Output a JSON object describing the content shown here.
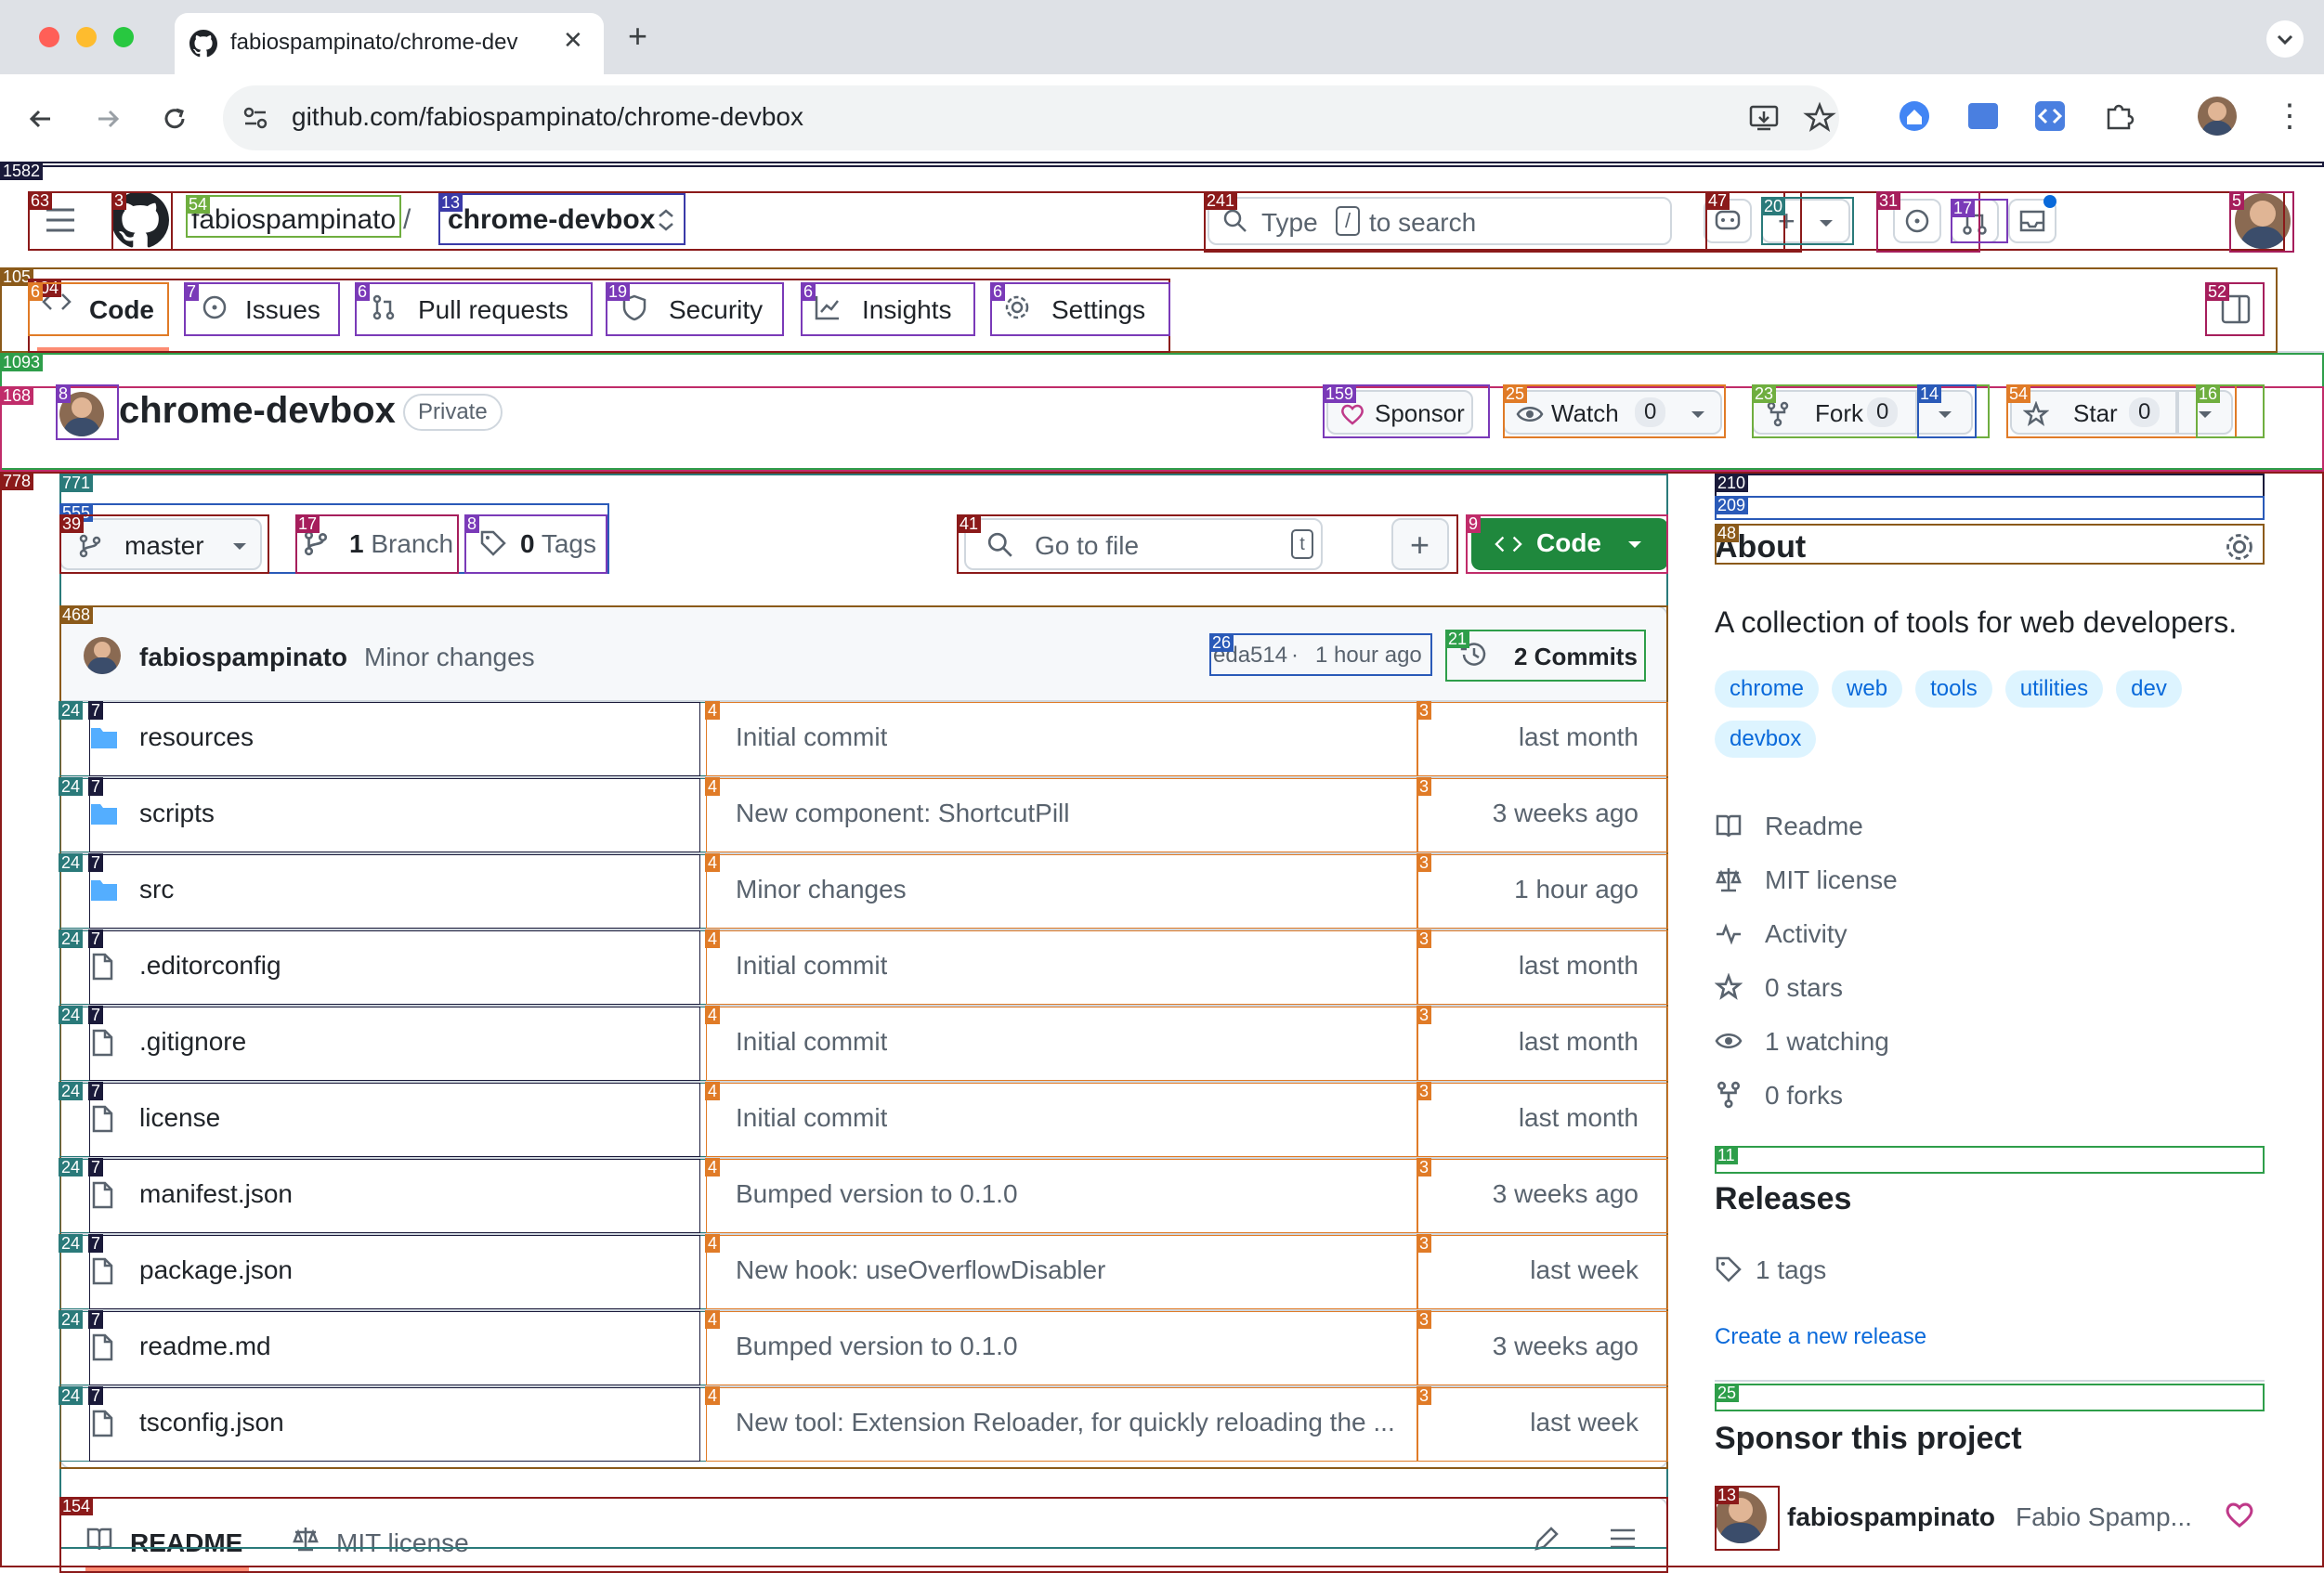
{
  "browser": {
    "tab_title": "fabiospampinato/chrome-dev",
    "new_tab": "+",
    "url": "github.com/fabiospampinato/chrome-devbox"
  },
  "header": {
    "owner": "fabiospampinato",
    "repo": "chrome-devbox",
    "search_placeholder_pre": "Type",
    "search_placeholder_post": "to search",
    "search_key": "/"
  },
  "nav": {
    "tabs": [
      {
        "label": "Code"
      },
      {
        "label": "Issues"
      },
      {
        "label": "Pull requests"
      },
      {
        "label": "Security"
      },
      {
        "label": "Insights"
      },
      {
        "label": "Settings"
      }
    ]
  },
  "repo_header": {
    "name": "chrome-devbox",
    "visibility": "Private",
    "sponsor": "Sponsor",
    "watch": "Watch",
    "watch_count": "0",
    "fork": "Fork",
    "fork_count": "0",
    "star": "Star",
    "star_count": "0"
  },
  "files_toolbar": {
    "branch": "master",
    "branches": "Branch",
    "tags": "Tags",
    "go_to_file": "Go to file",
    "code_button": "Code"
  },
  "latest_commit": {
    "author": "fabiospampinato",
    "message": "Minor changes",
    "hash": "eda514",
    "sep": "·",
    "time": "1 hour ago",
    "commits": "2 Commits"
  },
  "files": [
    {
      "name": "resources",
      "type": "folder",
      "message": "Initial commit",
      "date": "last month"
    },
    {
      "name": "scripts",
      "type": "folder",
      "message": "New component: ShortcutPill",
      "date": "3 weeks ago"
    },
    {
      "name": "src",
      "type": "folder",
      "message": "Minor changes",
      "date": "1 hour ago"
    },
    {
      "name": ".editorconfig",
      "type": "file",
      "message": "Initial commit",
      "date": "last month"
    },
    {
      "name": ".gitignore",
      "type": "file",
      "message": "Initial commit",
      "date": "last month"
    },
    {
      "name": "license",
      "type": "file",
      "message": "Initial commit",
      "date": "last month"
    },
    {
      "name": "manifest.json",
      "type": "file",
      "message": "Bumped version to 0.1.0",
      "date": "3 weeks ago"
    },
    {
      "name": "package.json",
      "type": "file",
      "message": "New hook: useOverflowDisabler",
      "date": "last week"
    },
    {
      "name": "readme.md",
      "type": "file",
      "message": "Bumped version to 0.1.0",
      "date": "3 weeks ago"
    },
    {
      "name": "tsconfig.json",
      "type": "file",
      "message": "New tool: Extension Reloader, for quickly reloading the ...",
      "date": "last week"
    }
  ],
  "readme_tabs": {
    "readme": "README",
    "license": "MIT license"
  },
  "about": {
    "title": "About",
    "description": "A collection of tools for web developers.",
    "topics": [
      "chrome",
      "web",
      "tools",
      "utilities",
      "dev",
      "devbox"
    ],
    "readme": "Readme",
    "license": "MIT license",
    "activity": "Activity",
    "stars": "0 stars",
    "watching": "1 watching",
    "forks": "0 forks"
  },
  "releases": {
    "title": "Releases",
    "tags": "1 tags",
    "create": "Create a new release"
  },
  "sponsor_section": {
    "title": "Sponsor this project",
    "user": "fabiospampinato",
    "full_name": "Fabio Spamp..."
  },
  "colors": {
    "accent": "#0969da",
    "code_button": "#1f883d",
    "tab_underline": "#fd8c73"
  },
  "overlay_labels": {
    "page": "1582",
    "hamburger": "63",
    "logo": "3",
    "owner": "54",
    "repo": "13",
    "search": "241",
    "sep": "47",
    "issues_btn": "20",
    "pr_btn": "31",
    "notif": "17",
    "avatar": "5",
    "nav": "105",
    "nav_inner": "104",
    "code_tab": "6",
    "issues_tab": "7",
    "pr_tab": "6",
    "security_tab": "19",
    "insights_tab": "6",
    "settings_tab": "6",
    "nav_more": "52",
    "repohead": "1093",
    "repohead_inner": "168",
    "rh_avatar": "8",
    "sponsor_btn": "159",
    "watch_btn": "25",
    "fork_btn": "23",
    "fork_menu": "14",
    "star_btn": "54",
    "star_menu": "16",
    "main": "778",
    "files_wrap": "771",
    "files_inner": "555",
    "branch_btn": "39",
    "branches_btn": "17",
    "tags_btn": "8",
    "goto": "41",
    "code_btn": "9",
    "commit_box": "468",
    "commit_meta": "26",
    "commits_link": "21",
    "row": "24",
    "row_icon": "7",
    "col_msg": "4",
    "col_date": "3",
    "readme_box": "154",
    "sidebar": "210",
    "sidebar_inner": "209",
    "about_head": "48",
    "releases_head": "11",
    "sponsor_head": "25",
    "sp_avatar": "13"
  }
}
